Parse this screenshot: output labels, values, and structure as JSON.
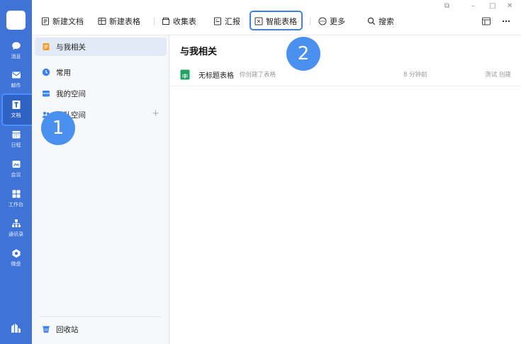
{
  "rail": {
    "items": [
      {
        "label": "消息",
        "icon": "chat-icon"
      },
      {
        "label": "邮件",
        "icon": "mail-icon"
      },
      {
        "label": "文档",
        "icon": "document-icon"
      },
      {
        "label": "日程",
        "icon": "calendar-icon"
      },
      {
        "label": "会议",
        "icon": "meeting-icon"
      },
      {
        "label": "工作台",
        "icon": "workbench-icon"
      },
      {
        "label": "通讯录",
        "icon": "contacts-icon"
      },
      {
        "label": "微盘",
        "icon": "cloud-drive-icon"
      }
    ],
    "active_item": "文档"
  },
  "toolbar": {
    "new_doc": "新建文档",
    "new_sheet": "新建表格",
    "collect_form": "收集表",
    "report": "汇报",
    "smart_sheet": "智能表格",
    "more": "更多",
    "search": "搜索"
  },
  "sidebar": {
    "items": [
      {
        "label": "与我相关"
      },
      {
        "label": "常用"
      },
      {
        "label": "我的空间"
      },
      {
        "label": "团队空间"
      }
    ],
    "recycle_bin": "回收站"
  },
  "main": {
    "title": "与我相关",
    "files": [
      {
        "name": "无标题表格",
        "desc": "你创建了表格",
        "time": "8 分钟前",
        "creator": "测试 创建"
      }
    ]
  },
  "annotations": [
    "1",
    "2"
  ],
  "colors": {
    "rail": "#3f73d6",
    "accent": "#3b82f0",
    "badge": "#4a90ee",
    "sheet_icon": "#21a366"
  }
}
